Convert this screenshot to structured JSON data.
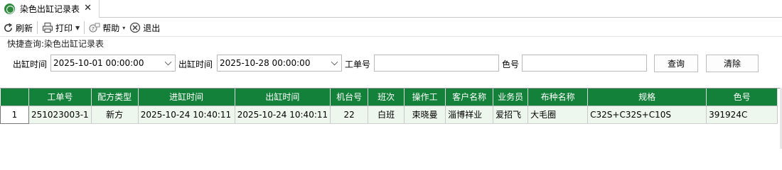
{
  "tab": {
    "title": "染色出缸记录表",
    "close": "✕"
  },
  "toolbar": {
    "refresh": "刷新",
    "print": "打印",
    "help": "帮助",
    "exit": "退出"
  },
  "query": {
    "panel_title": "快捷查询:染色出缸记录表",
    "out_time_label_1": "出缸时间",
    "out_time_start": "2025-10-01 00:00:00",
    "out_time_label_2": "出缸时间",
    "out_time_end": "2025-10-28 00:00:00",
    "work_no_label": "工单号",
    "work_no_value": "",
    "color_no_label": "色号",
    "color_no_value": "",
    "query_button": "查询",
    "clear_button": "清除"
  },
  "table": {
    "columns": [
      "工单号",
      "配方类型",
      "进缸时间",
      "出缸时间",
      "机台号",
      "班次",
      "操作工",
      "客户名称",
      "业务员",
      "布种名称",
      "规格",
      "色号"
    ],
    "rows": [
      {
        "row_no": "1",
        "cells": [
          "251023003-1",
          "新方",
          "2025-10-24 10:40:11",
          "2025-10-24 10:40:11",
          "22",
          "白班",
          "束晓曼",
          "淄博祥业",
          "爱招飞",
          "大毛圈",
          "C32S+C32S+C10S",
          "391924C"
        ]
      }
    ]
  },
  "colors": {
    "header_green": "#14813a",
    "row_bg": "#eef7ee"
  }
}
